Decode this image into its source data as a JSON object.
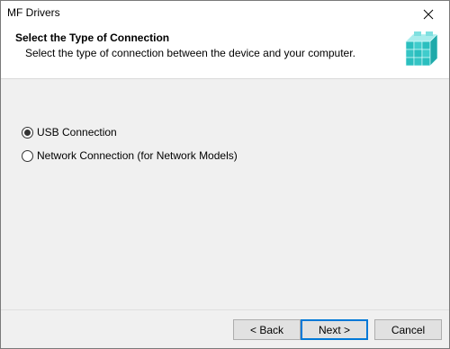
{
  "window": {
    "title": "MF Drivers"
  },
  "header": {
    "title": "Select the Type of Connection",
    "subtitle": "Select the type of connection between the device and your computer."
  },
  "options": [
    {
      "label": "USB Connection",
      "selected": true
    },
    {
      "label": "Network Connection (for Network Models)",
      "selected": false
    }
  ],
  "buttons": {
    "back": "< Back",
    "next": "Next >",
    "cancel": "Cancel"
  },
  "icons": {
    "close": "close-icon",
    "header": "installer-cubes-icon"
  },
  "colors": {
    "accent": "#0078d7",
    "cube_teal": "#2bbfbf",
    "cube_light": "#a8ecec"
  }
}
